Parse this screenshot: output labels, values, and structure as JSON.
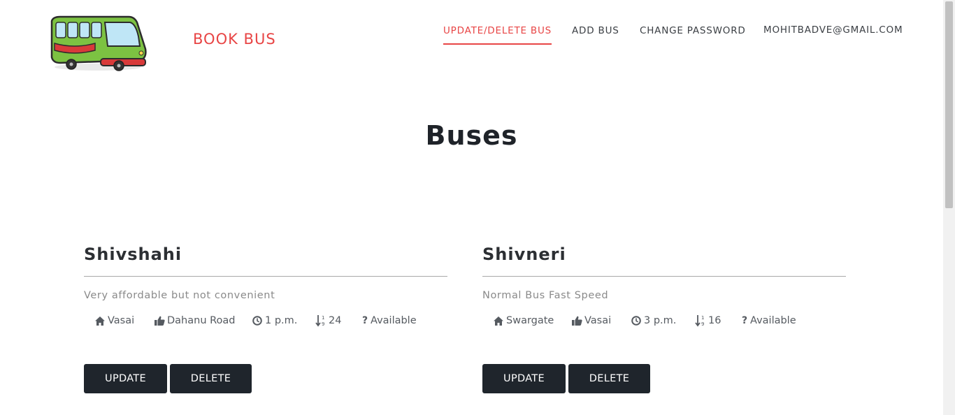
{
  "brand": {
    "name": "BOOK BUS"
  },
  "nav": {
    "items": [
      {
        "label": "UPDATE/DELETE BUS",
        "active": true
      },
      {
        "label": "ADD BUS",
        "active": false
      },
      {
        "label": "CHANGE PASSWORD",
        "active": false
      },
      {
        "label": "MOHITBADVE@GMAIL.COM",
        "active": false
      }
    ]
  },
  "page": {
    "title": "Buses"
  },
  "buses": [
    {
      "name": "Shivshahi",
      "description": "Very affordable but not convenient",
      "from": "Vasai",
      "to": "Dahanu Road",
      "time": "1 p.m.",
      "seats": "24",
      "status": "Available",
      "update_label": "UPDATE",
      "delete_label": "DELETE"
    },
    {
      "name": "Shivneri",
      "description": "Normal Bus Fast Speed",
      "from": "Swargate",
      "to": "Vasai",
      "time": "3 p.m.",
      "seats": "16",
      "status": "Available",
      "update_label": "UPDATE",
      "delete_label": "DELETE"
    }
  ],
  "icons": {
    "from": "home-icon",
    "to": "thumbs-up-icon",
    "time": "clock-icon",
    "seats": "sort-numeric-icon",
    "status": "question-icon"
  },
  "colors": {
    "accent": "#e84545",
    "button": "#1f252c",
    "text": "#212529"
  }
}
